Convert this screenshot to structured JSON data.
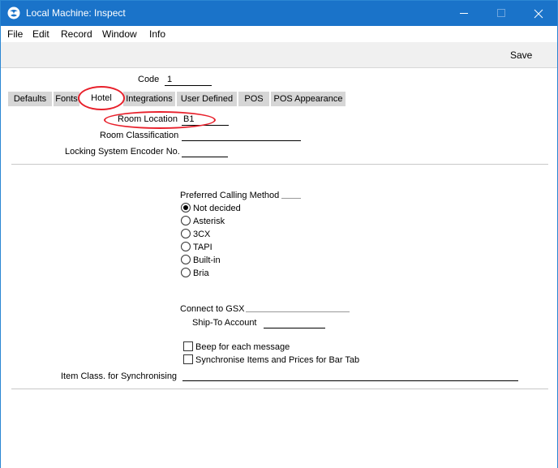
{
  "window": {
    "title": "Local Machine: Inspect",
    "controls": {
      "minimize": "minimize",
      "maximize": "maximize",
      "close": "close"
    }
  },
  "menu": [
    "File",
    "Edit",
    "Record",
    "Window",
    "Info"
  ],
  "toolbar": {
    "save_label": "Save"
  },
  "header": {
    "code_label": "Code",
    "code_value": "1"
  },
  "tabs": [
    {
      "label": "Defaults"
    },
    {
      "label": "Fonts"
    },
    {
      "label": "Hotel",
      "active": true
    },
    {
      "label": "Integrations"
    },
    {
      "label": "User Defined"
    },
    {
      "label": "POS"
    },
    {
      "label": "POS Appearance"
    }
  ],
  "hotel": {
    "room_location_label": "Room Location",
    "room_location_value": "B1",
    "room_classification_label": "Room Classification",
    "room_classification_value": "",
    "locking_encoder_label": "Locking System Encoder No.",
    "locking_encoder_value": "",
    "calling_method_label": "Preferred Calling Method",
    "calling_methods": [
      {
        "label": "Not decided",
        "selected": true
      },
      {
        "label": "Asterisk",
        "selected": false
      },
      {
        "label": "3CX",
        "selected": false
      },
      {
        "label": "TAPI",
        "selected": false
      },
      {
        "label": "Built-in",
        "selected": false
      },
      {
        "label": "Bria",
        "selected": false
      }
    ],
    "connect_gsx_label": "Connect to GSX",
    "connect_gsx_value": "",
    "ship_to_label": "Ship-To Account",
    "ship_to_value": "",
    "beep_label": "Beep for each message",
    "beep_checked": false,
    "sync_label": "Synchronise Items and Prices for Bar Tab",
    "sync_checked": false,
    "item_class_label": "Item Class. for Synchronising",
    "item_class_value": ""
  },
  "colors": {
    "titlebar": "#1a73c9",
    "highlight": "#e8202b",
    "tab_inactive": "#d6d6d6",
    "toolbar_bg": "#f0f0f0"
  }
}
